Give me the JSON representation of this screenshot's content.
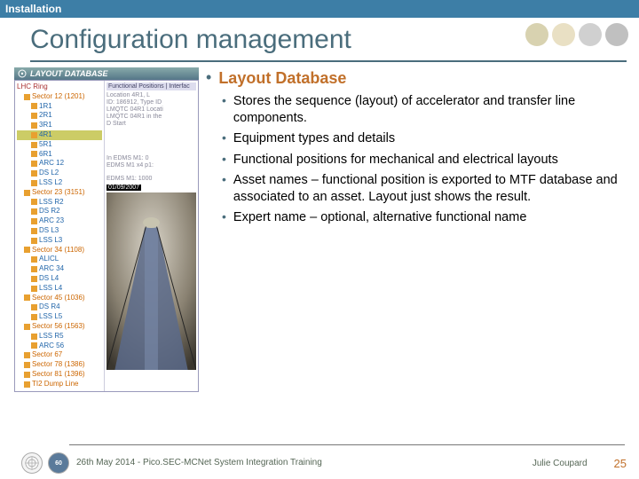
{
  "topbar": "Installation",
  "title": "Configuration management",
  "section_header": "Layout Database",
  "ldb_heading": "LAYOUT DATABASE",
  "ldb_tabs": "Functional Positions | Interfac",
  "ldb_loc": "Location 4R1, L",
  "ldb_line1": "ID: 186912, Type ID",
  "ldb_line2": "LMQTC 04R1 Locati",
  "ldb_line3": "LMQTC 04R1 in the",
  "ldb_ds": "D Start",
  "ldb_edms1": "In EDMS M1: 0",
  "ldb_edms2": "EDMS M1 x4 p1:",
  "ldb_edms3": "EDMS M1: 1000",
  "ldb_date": "01/09/2007",
  "tree": {
    "root": "LHC Ring",
    "s12": "Sector 12 (1201)",
    "s12_items": [
      "1R1",
      "2R1",
      "3R1",
      "4R1",
      "5R1",
      "6R1",
      "ARC 12",
      "DS L2",
      "LSS L2"
    ],
    "s23": "Sector 23 (3151)",
    "s23_items": [
      "LSS R2",
      "DS R2",
      "ARC 23",
      "DS L3",
      "LSS L3"
    ],
    "s34": "Sector 34 (1108)",
    "s34_items": [
      "ALICL",
      "ARC 34",
      "DS L4",
      "LSS L4"
    ],
    "s45": "Sector 45 (1036)",
    "s45_items": [
      "DS R4",
      "LSS L5"
    ],
    "s56": "Sector 56 (1563)",
    "s56_items": [
      "LSS R5",
      "ARC 56"
    ],
    "s67": "Sector 67",
    "s78": "Sector 78 (1386)",
    "s81": "Sector 81 (1396)",
    "dump": "TI2 Dump Line"
  },
  "bullets": [
    "Stores the sequence (layout) of accelerator and transfer line components.",
    "Equipment types and details",
    "Functional positions for mechanical and electrical layouts",
    "Asset names – functional position is exported to MTF database and associated to an asset. Layout just shows the result.",
    "Expert name – optional, alternative functional name"
  ],
  "footer": {
    "text": "26th May 2014 - Pico.SEC-MCNet System Integration Training",
    "author": "Julie Coupard",
    "page": "25"
  }
}
